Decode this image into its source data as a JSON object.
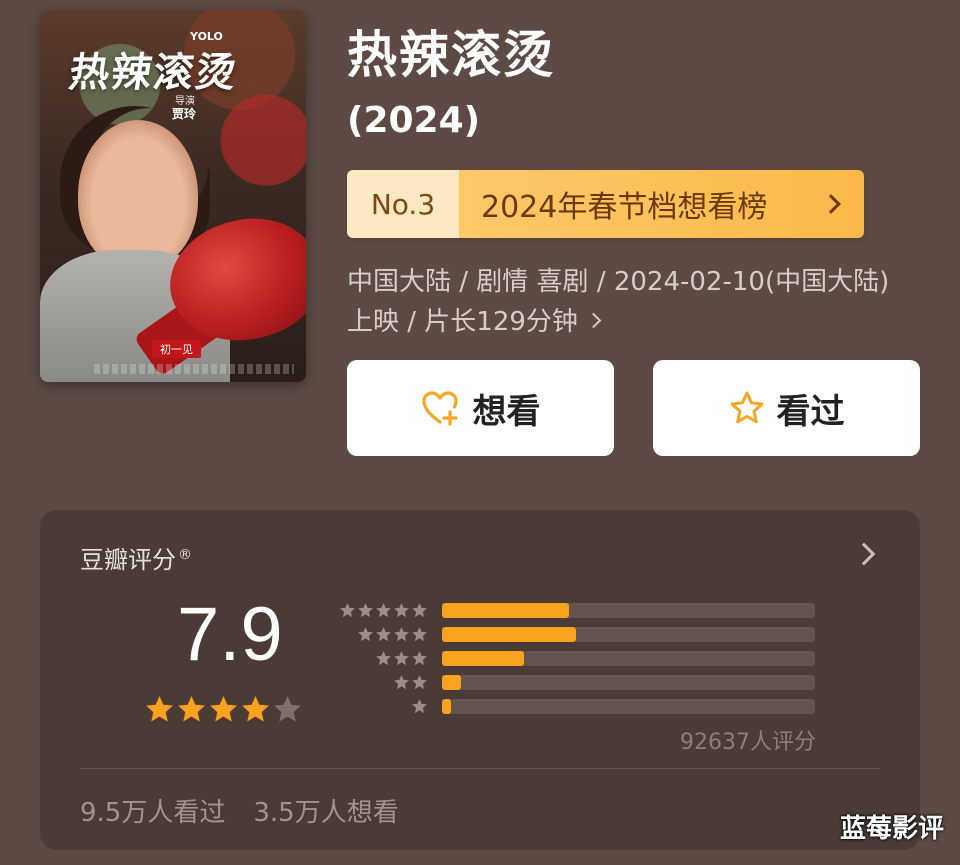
{
  "poster": {
    "title_art": "热辣滚烫",
    "brand": "YOLO",
    "director_label": "导演",
    "director": "贾玲",
    "badge": "初一见"
  },
  "movie": {
    "title": "热辣滚烫",
    "year": "(2024)"
  },
  "ranking": {
    "number": "No.3",
    "label": "2024年春节档想看榜"
  },
  "meta": {
    "line1": "中国大陆 / 剧情 喜剧 / 2024-02-10(中国大陆)",
    "line2": "上映 / 片长129分钟"
  },
  "actions": {
    "want_label": "想看",
    "want_icon": "heart-plus-icon",
    "seen_label": "看过",
    "seen_icon": "star-outline-icon"
  },
  "rating": {
    "title": "豆瓣评分",
    "registered_mark": "®",
    "score": "7.9",
    "stars": 4,
    "bars": [
      {
        "stars": 5,
        "fraction": 0.34
      },
      {
        "stars": 4,
        "fraction": 0.36
      },
      {
        "stars": 3,
        "fraction": 0.22
      },
      {
        "stars": 2,
        "fraction": 0.05
      },
      {
        "stars": 1,
        "fraction": 0.025
      }
    ],
    "votes": "92637人评分",
    "seen_count": "9.5万人看过",
    "want_count": "3.5万人想看"
  },
  "colors": {
    "background": "#5d4a44",
    "card": "#4a3b36",
    "accent_orange": "#f8a21e",
    "rank_banner": "#fbb94a"
  },
  "watermark": "蓝莓影评"
}
